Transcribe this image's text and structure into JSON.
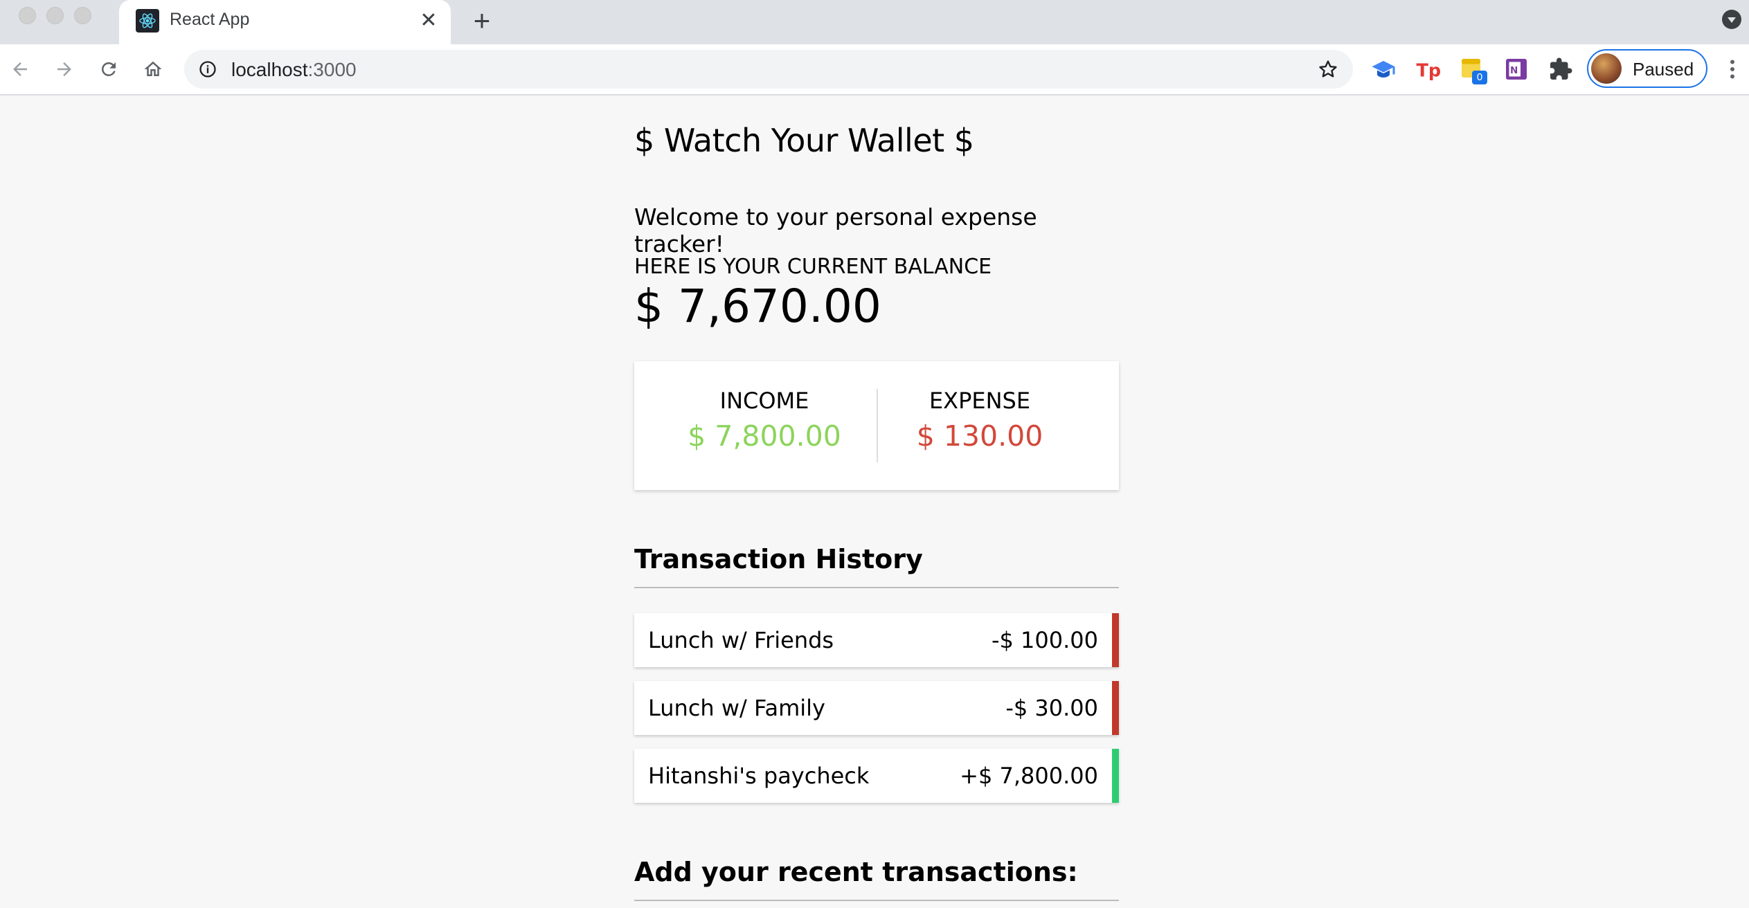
{
  "browser": {
    "tab_title": "React App",
    "tab_close_glyph": "✕",
    "new_tab_glyph": "+",
    "url_host": "localhost",
    "url_port": ":3000",
    "extension_badge": "0",
    "profile_label": "Paused",
    "icons": [
      "react-favicon",
      "back-arrow-icon",
      "forward-arrow-icon",
      "reload-icon",
      "home-icon",
      "site-info-icon",
      "bookmark-star-icon",
      "graduation-cap-icon",
      "tp-extension-icon",
      "notes-extension-icon",
      "onenote-icon",
      "puzzle-extensions-icon",
      "more-menu-icon"
    ]
  },
  "app": {
    "title": "$ Watch Your Wallet $",
    "welcome": "Welcome to your personal expense tracker!",
    "balance_label": "HERE IS YOUR CURRENT BALANCE",
    "balance_value": "$ 7,670.00"
  },
  "summary": {
    "income_label": "INCOME",
    "income_value": "$ 7,800.00",
    "expense_label": "EXPENSE",
    "expense_value": "$ 130.00"
  },
  "history": {
    "title": "Transaction History",
    "transactions": [
      {
        "name": "Lunch w/ Friends",
        "amount": "-$ 100.00",
        "type": "expense"
      },
      {
        "name": "Lunch w/ Family",
        "amount": "-$ 30.00",
        "type": "expense"
      },
      {
        "name": "Hitanshi's paycheck",
        "amount": "+$ 7,800.00",
        "type": "income"
      }
    ]
  },
  "add_section": {
    "title": "Add your recent transactions:"
  },
  "colors": {
    "income_green": "#8cd45c",
    "expense_red": "#d2483a",
    "income_bar": "#2ecc71",
    "expense_bar": "#c0392b",
    "accent_blue": "#1a73e8"
  }
}
